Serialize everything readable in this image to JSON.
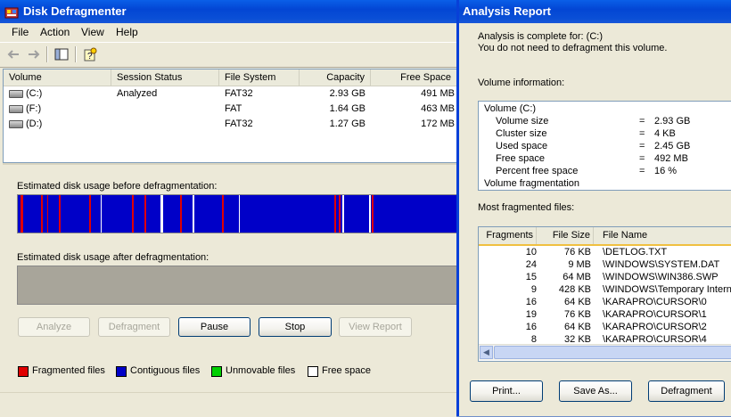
{
  "main": {
    "title": "Disk Defragmenter",
    "menu": [
      "File",
      "Action",
      "View",
      "Help"
    ],
    "columns": [
      "Volume",
      "Session Status",
      "File System",
      "Capacity",
      "Free Space"
    ],
    "volumes": [
      {
        "volume": "(C:)",
        "status": "Analyzed",
        "fs": "FAT32",
        "capacity": "2.93 GB",
        "free": "491 MB"
      },
      {
        "volume": "(F:)",
        "status": "",
        "fs": "FAT",
        "capacity": "1.64 GB",
        "free": "463 MB"
      },
      {
        "volume": "(D:)",
        "status": "",
        "fs": "FAT32",
        "capacity": "1.27 GB",
        "free": "172 MB"
      }
    ],
    "before_label": "Estimated disk usage before defragmentation:",
    "after_label": "Estimated disk usage after defragmentation:",
    "buttons": {
      "analyze": "Analyze",
      "defragment": "Defragment",
      "pause": "Pause",
      "stop": "Stop",
      "view_report": "View Report"
    },
    "legend": {
      "fragmented": "Fragmented files",
      "contiguous": "Contiguous files",
      "unmovable": "Unmovable files",
      "free": "Free space"
    },
    "colors": {
      "fragmented": "#e00000",
      "contiguous": "#0000c8",
      "unmovable": "#00d000",
      "free": "#ffffff"
    }
  },
  "report": {
    "title": "Analysis Report",
    "line1": "Analysis is complete for: (C:)",
    "line2": "You do not need to defragment this volume.",
    "volume_info_label": "Volume information:",
    "volume_info": {
      "header": "Volume  (C:)",
      "rows": [
        {
          "k": "Volume size",
          "v": "2.93 GB"
        },
        {
          "k": "Cluster size",
          "v": "4 KB"
        },
        {
          "k": "Used space",
          "v": "2.45 GB"
        },
        {
          "k": "Free space",
          "v": "492 MB"
        },
        {
          "k": "Percent free space",
          "v": "16 %"
        }
      ],
      "eq": "=",
      "footer": "Volume fragmentation"
    },
    "most_fragmented_label": "Most fragmented files:",
    "frag_columns": [
      "Fragments",
      "File Size",
      "File Name"
    ],
    "frag_files": [
      {
        "frags": "10",
        "size": "76 KB",
        "name": "\\DETLOG.TXT"
      },
      {
        "frags": "24",
        "size": "9 MB",
        "name": "\\WINDOWS\\SYSTEM.DAT"
      },
      {
        "frags": "15",
        "size": "64 MB",
        "name": "\\WINDOWS\\WIN386.SWP"
      },
      {
        "frags": "9",
        "size": "428 KB",
        "name": "\\WINDOWS\\Temporary Interne"
      },
      {
        "frags": "16",
        "size": "64 KB",
        "name": "\\KARAPRO\\CURSOR\\0"
      },
      {
        "frags": "19",
        "size": "76 KB",
        "name": "\\KARAPRO\\CURSOR\\1"
      },
      {
        "frags": "16",
        "size": "64 KB",
        "name": "\\KARAPRO\\CURSOR\\2"
      },
      {
        "frags": "8",
        "size": "32 KB",
        "name": "\\KARAPRO\\CURSOR\\4"
      }
    ],
    "buttons": {
      "print": "Print...",
      "save_as": "Save As...",
      "defragment": "Defragment"
    }
  }
}
